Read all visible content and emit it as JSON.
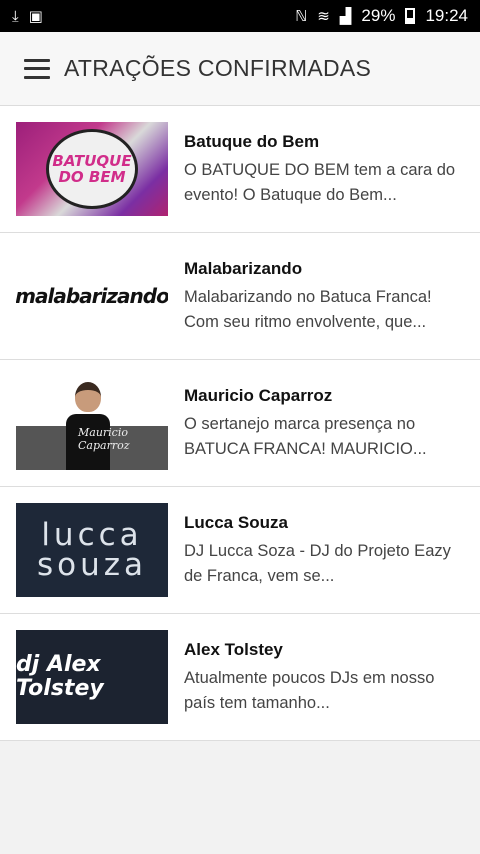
{
  "statusbar": {
    "battery": "29%",
    "time": "19:24"
  },
  "toolbar": {
    "title": "ATRAÇÕES CONFIRMADAS"
  },
  "attractions": [
    {
      "name": "Batuque do Bem",
      "description": "O BATUQUE DO BEM tem a cara do evento! O Batuque do Bem...",
      "logo_text": "BATUQUE DO BEM"
    },
    {
      "name": "Malabarizando",
      "description": "Malabarizando no Batuca Franca! Com seu ritmo envolvente, que...",
      "logo_text": "malabarizando"
    },
    {
      "name": "Mauricio Caparroz",
      "description": "O sertanejo marca presença no BATUCA FRANCA! MAURICIO...",
      "logo_text": "Mauricio Caparroz"
    },
    {
      "name": "Lucca Souza",
      "description": "DJ Lucca Soza - DJ do Projeto Eazy de Franca, vem se...",
      "logo_text": "lucca souza"
    },
    {
      "name": "Alex Tolstey",
      "description": "Atualmente poucos DJs em nosso país tem tamanho...",
      "logo_text": "dj Alex Tolstey"
    }
  ]
}
